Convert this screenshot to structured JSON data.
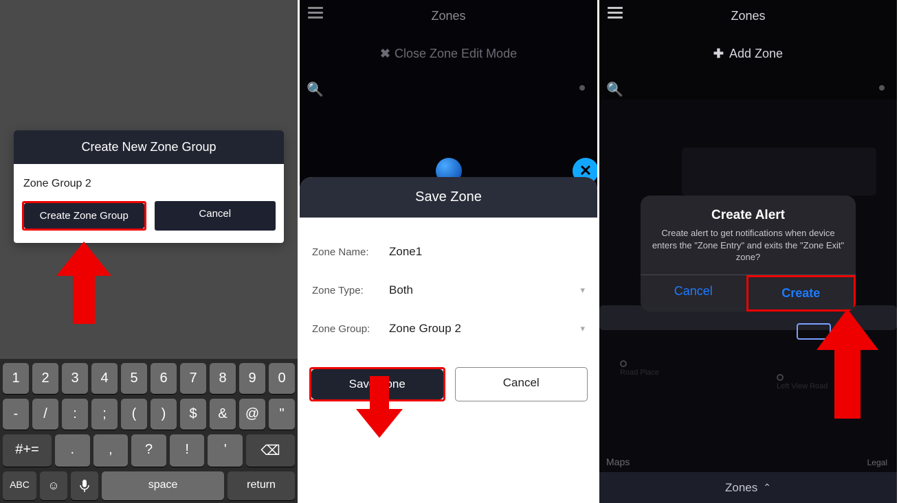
{
  "screen1": {
    "dialog_title": "Create New Zone Group",
    "input_value": "Zone Group 2",
    "create_btn": "Create Zone Group",
    "cancel_btn": "Cancel",
    "keyboard": {
      "row1": [
        "1",
        "2",
        "3",
        "4",
        "5",
        "6",
        "7",
        "8",
        "9",
        "0"
      ],
      "row2": [
        "-",
        "/",
        ":",
        ";",
        "(",
        ")",
        "$",
        "&",
        "@",
        "\""
      ],
      "row3_shift": "#+=",
      "row3": [
        ".",
        ",",
        "?",
        "!",
        "'"
      ],
      "row3_backspace": "⌫",
      "row4_abc": "ABC",
      "row4_emoji": "☺",
      "row4_mic": "🎤",
      "row4_space": "space",
      "row4_return": "return"
    }
  },
  "screen2": {
    "topbar_title": "Zones",
    "close_edit": "Close Zone Edit Mode",
    "sheet_title": "Save Zone",
    "fields": {
      "name_label": "Zone Name:",
      "name_value": "Zone1",
      "type_label": "Zone Type:",
      "type_value": "Both",
      "group_label": "Zone Group:",
      "group_value": "Zone Group 2"
    },
    "save_btn": "Save Zone",
    "cancel_btn": "Cancel"
  },
  "screen3": {
    "topbar_title": "Zones",
    "add_zone": "Add Zone",
    "maps_label": "Maps",
    "legal_label": "Legal",
    "poi_left": "Road Place",
    "poi_right": "Left View Road",
    "alert_title": "Create Alert",
    "alert_msg": "Create alert to get notifications when device enters the \"Zone Entry\" and exits the \"Zone Exit\" zone?",
    "cancel_btn": "Cancel",
    "create_btn": "Create",
    "bottom_label": "Zones"
  }
}
